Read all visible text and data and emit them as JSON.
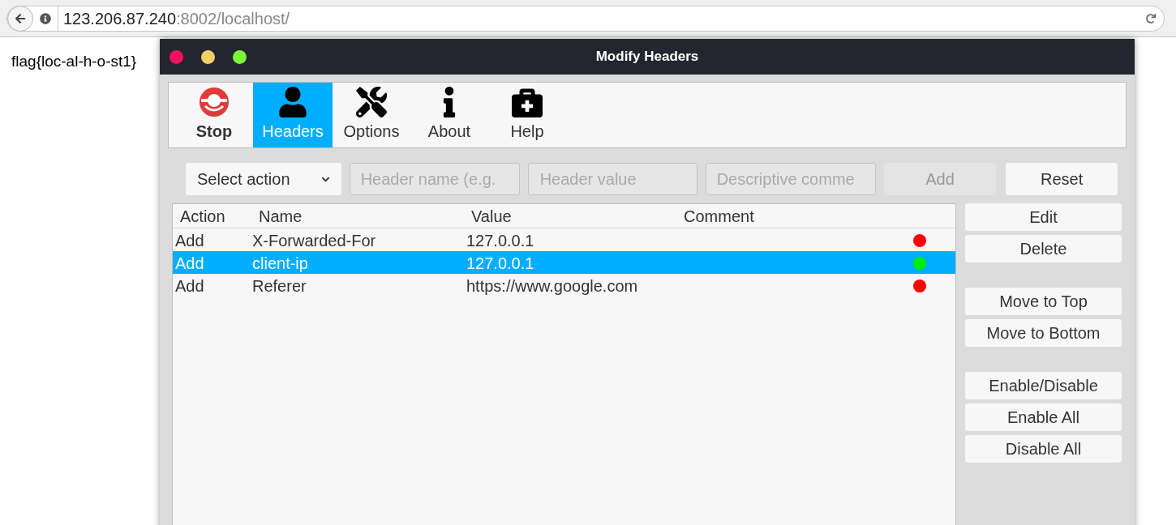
{
  "browser": {
    "url_host": "123.206.87.240",
    "url_rest": ":8002/localhost/"
  },
  "page": {
    "text": "flag{loc-al-h-o-st1}"
  },
  "window": {
    "title": "Modify Headers"
  },
  "tabs": [
    {
      "label": "Stop",
      "kind": "stop",
      "selected": false
    },
    {
      "label": "Headers",
      "kind": "person",
      "selected": true
    },
    {
      "label": "Options",
      "kind": "tools",
      "selected": false
    },
    {
      "label": "About",
      "kind": "info",
      "selected": false
    },
    {
      "label": "Help",
      "kind": "medkit",
      "selected": false
    }
  ],
  "form": {
    "action": "Select action",
    "name_placeholder": "Header name (e.g.",
    "value_placeholder": "Header value",
    "comment_placeholder": "Descriptive comme",
    "add": "Add",
    "reset": "Reset"
  },
  "table": {
    "columns": [
      "Action",
      "Name",
      "Value",
      "Comment"
    ],
    "rows": [
      {
        "action": "Add",
        "name": "X-Forwarded-For",
        "value": "127.0.0.1",
        "color": "#ff0000",
        "selected": false
      },
      {
        "action": "Add",
        "name": "client-ip",
        "value": "127.0.0.1",
        "color": "#00ee00",
        "selected": true
      },
      {
        "action": "Add",
        "name": "Referer",
        "value": "https://www.google.com",
        "color": "#ff0000",
        "selected": false
      }
    ]
  },
  "side_buttons": [
    [
      "Edit",
      "Delete"
    ],
    [
      "Move to Top",
      "Move to Bottom"
    ],
    [
      "Enable/Disable",
      "Enable All",
      "Disable All"
    ]
  ]
}
